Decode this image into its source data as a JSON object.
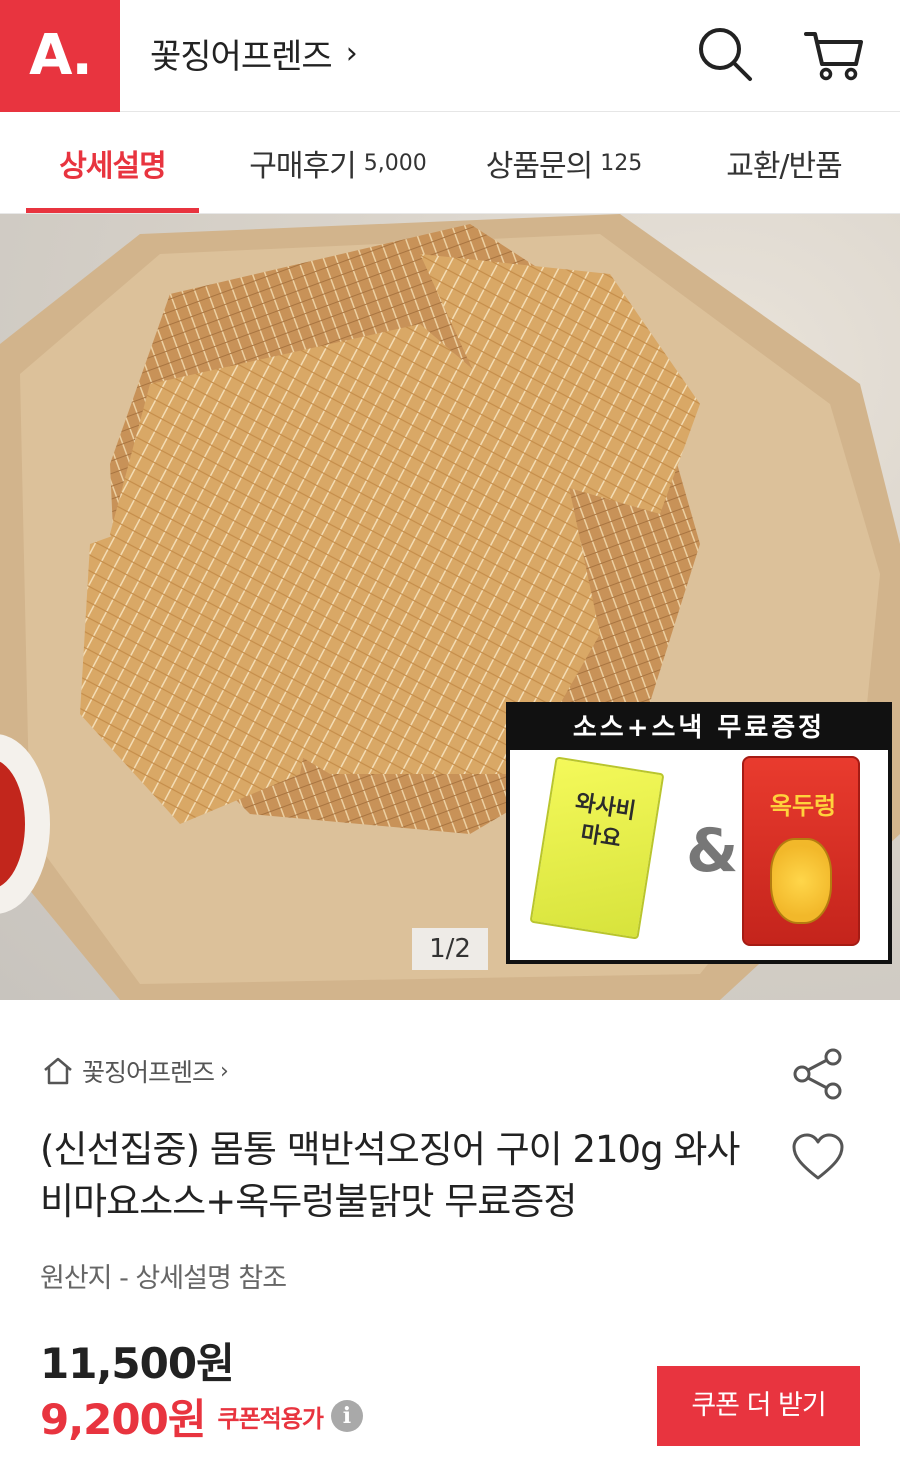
{
  "header": {
    "logo_text": "A.",
    "store_name": "꽃징어프렌즈",
    "store_chevron": "›",
    "icons": [
      "search-icon",
      "cart-icon"
    ]
  },
  "tabs": [
    {
      "label": "상세설명",
      "count": "",
      "active": true
    },
    {
      "label": "구매후기",
      "count": "5,000",
      "active": false
    },
    {
      "label": "상품문의",
      "count": "125",
      "active": false
    },
    {
      "label": "교환/반품",
      "count": "",
      "active": false
    }
  ],
  "hero": {
    "promo_title": "소스+스낵 무료증정",
    "sauce_label": "와사비 마요",
    "ampersand": "&",
    "snack_label": "옥두렁",
    "page_indicator": "1/2"
  },
  "product": {
    "breadcrumb_store": "꽃징어프렌즈",
    "breadcrumb_chevron": "›",
    "title": "(신선집중) 몸통 맥반석오징어 구이 210g 와사비마요소스+옥두렁불닭맛 무료증정",
    "origin": "원산지 - 상세설명 참조",
    "price_original": "11,500원",
    "price_sale": "9,200원",
    "coupon_price_label": "쿠폰적용가",
    "info_glyph": "i",
    "coupon_button": "쿠폰 더 받기"
  },
  "colors": {
    "accent": "#e8343f",
    "text": "#222222",
    "muted": "#666666"
  }
}
